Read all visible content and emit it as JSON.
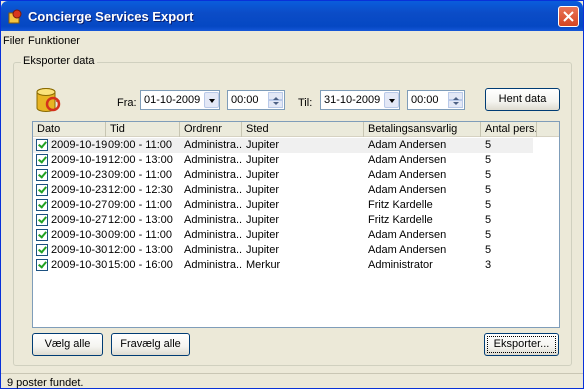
{
  "window": {
    "title": "Concierge Services Export"
  },
  "menu": {
    "items": [
      "Filer",
      "Funktioner"
    ]
  },
  "group": {
    "label": "Eksporter data"
  },
  "filters": {
    "from_label": "Fra:",
    "from_date": "01-10-2009",
    "from_time": "00:00",
    "to_label": "Til:",
    "to_date": "31-10-2009",
    "to_time": "00:00",
    "fetch_label": "Hent data"
  },
  "table": {
    "columns": [
      "Dato",
      "Tid",
      "Ordrenr",
      "Sted",
      "Betalingsansvarlig",
      "Antal pers."
    ],
    "rows": [
      [
        "2009-10-19",
        "09:00 - 11:00",
        "Administra...",
        "Jupiter",
        "Adam Andersen",
        "5"
      ],
      [
        "2009-10-19",
        "12:00 - 13:00",
        "Administra...",
        "Jupiter",
        "Adam Andersen",
        "5"
      ],
      [
        "2009-10-23",
        "09:00 - 11:00",
        "Administra...",
        "Jupiter",
        "Adam Andersen",
        "5"
      ],
      [
        "2009-10-23",
        "12:00 - 12:30",
        "Administra...",
        "Jupiter",
        "Adam Andersen",
        "5"
      ],
      [
        "2009-10-27",
        "09:00 - 11:00",
        "Administra...",
        "Jupiter",
        "Fritz Kardelle",
        "5"
      ],
      [
        "2009-10-27",
        "12:00 - 13:00",
        "Administra...",
        "Jupiter",
        "Fritz Kardelle",
        "5"
      ],
      [
        "2009-10-30",
        "09:00 - 11:00",
        "Administra...",
        "Jupiter",
        "Adam Andersen",
        "5"
      ],
      [
        "2009-10-30",
        "12:00 - 13:00",
        "Administra...",
        "Jupiter",
        "Adam Andersen",
        "5"
      ],
      [
        "2009-10-30",
        "15:00 - 16:00",
        "Administra...",
        "Merkur",
        "Administrator",
        "3"
      ]
    ]
  },
  "buttons": {
    "select_all": "Vælg alle",
    "deselect_all": "Fravælg alle",
    "export": "Eksporter..."
  },
  "status": {
    "text": "9 poster fundet."
  }
}
